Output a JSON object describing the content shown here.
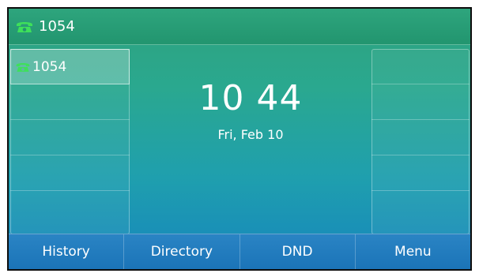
{
  "title_bar": {
    "account": "1054",
    "icon": "phone-icon",
    "icon_color": "#3ee05a"
  },
  "line_keys": {
    "left": [
      {
        "label": "1054",
        "icon": "phone-icon",
        "active": true
      },
      {
        "label": ""
      },
      {
        "label": ""
      },
      {
        "label": ""
      },
      {
        "label": ""
      }
    ],
    "right": [
      {
        "label": ""
      },
      {
        "label": ""
      },
      {
        "label": ""
      },
      {
        "label": ""
      },
      {
        "label": ""
      }
    ]
  },
  "idle": {
    "time": "10 44",
    "date": "Fri, Feb 10"
  },
  "softkeys": [
    "History",
    "Directory",
    "DND",
    "Menu"
  ]
}
